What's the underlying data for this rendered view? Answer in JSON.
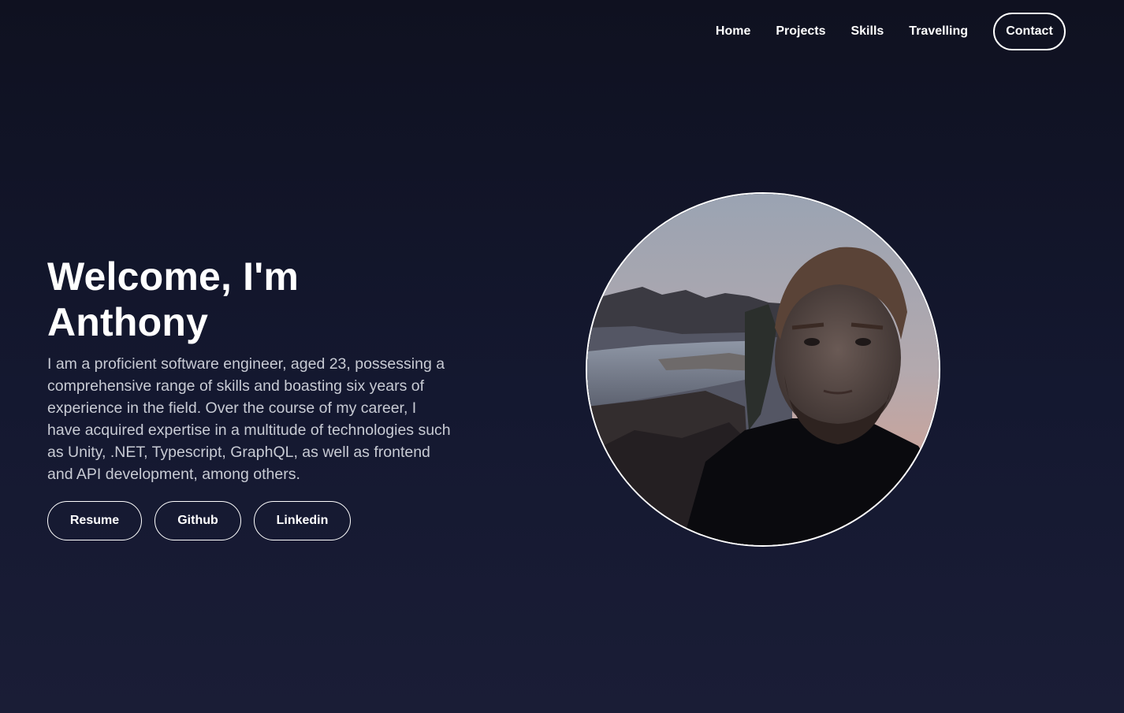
{
  "nav": {
    "links": [
      "Home",
      "Projects",
      "Skills",
      "Travelling"
    ],
    "contact_label": "Contact"
  },
  "hero": {
    "title": "Welcome, I'm Anthony",
    "description": "I am a proficient software engineer, aged 23, possessing a comprehensive range of skills and boasting six years of experience in the field. Over the course of my career, I have acquired expertise in a multitude of technologies such as Unity, .NET, Typescript, GraphQL, as well as frontend and API development, among others.",
    "buttons": {
      "resume": "Resume",
      "github": "Github",
      "linkedin": "Linkedin"
    }
  },
  "colors": {
    "background_top": "#0f1120",
    "background_bottom": "#1a1d36",
    "text": "#ffffff",
    "body_text": "#c8cbd4"
  }
}
